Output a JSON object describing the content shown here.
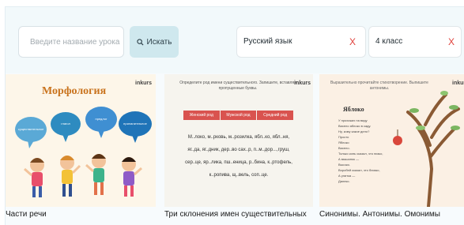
{
  "search": {
    "placeholder": "Введите название урока",
    "button_label": "Искать"
  },
  "filters": {
    "subject": {
      "value": "Русский язык",
      "clear_label": "X"
    },
    "grade": {
      "value": "4 класс",
      "clear_label": "X"
    }
  },
  "cards": [
    {
      "title": "Части речи",
      "thumbnail": {
        "badge": "inkurs",
        "heading": "Морфология",
        "bubbles": [
          "существительное",
          "глагол",
          "предлог",
          "прилагательное"
        ]
      }
    },
    {
      "title": "Три склонения имен существительных",
      "thumbnail": {
        "badge": "inkurs",
        "instruction": "Определите род имени существительного. Запишите, вставляя пропущенные буквы.",
        "headers": [
          "Женский род",
          "Мужской род",
          "Средний род"
        ],
        "rows": [
          "М..локо, м..рковь, м..розилка, ябл..ко, ябл..ня,",
          "яг..да, яг..дник, дер..во сах..р, п..м..дор...,груш,",
          "сер..це, яр..лика, пш..еница, р..бина, к..ртофель,",
          "к..ропива, щ..вель, соп..це."
        ]
      }
    },
    {
      "title": "Синонимы. Антонимы. Омонимы",
      "thumbnail": {
        "badge": "inkurs",
        "heading": "Выразительно прочитайте стихотворение. Выпишите антонимы.",
        "poem_title": "Яблоко",
        "poem_lines": [
          "У прохожих на виду",
          "Висело яблоко в саду.",
          "Ну, кому какое дело?",
          "Просто",
          "Яблоко",
          "Висело.",
          "Только конь сказал, что низко,",
          "А мышонок —",
          "Высоко.",
          "Воробей сказал, что близко,",
          "А улитка —",
          "Далеко."
        ]
      }
    }
  ],
  "colors": {
    "toolbar_bg": "#f2f9fb",
    "search_button_bg": "#cfe8ee",
    "clear_icon": "#e0413b",
    "table_header": "#d9534f",
    "morph_title": "#c9731d"
  },
  "icons": {
    "search": "magnifier",
    "clear": "x-mark"
  }
}
